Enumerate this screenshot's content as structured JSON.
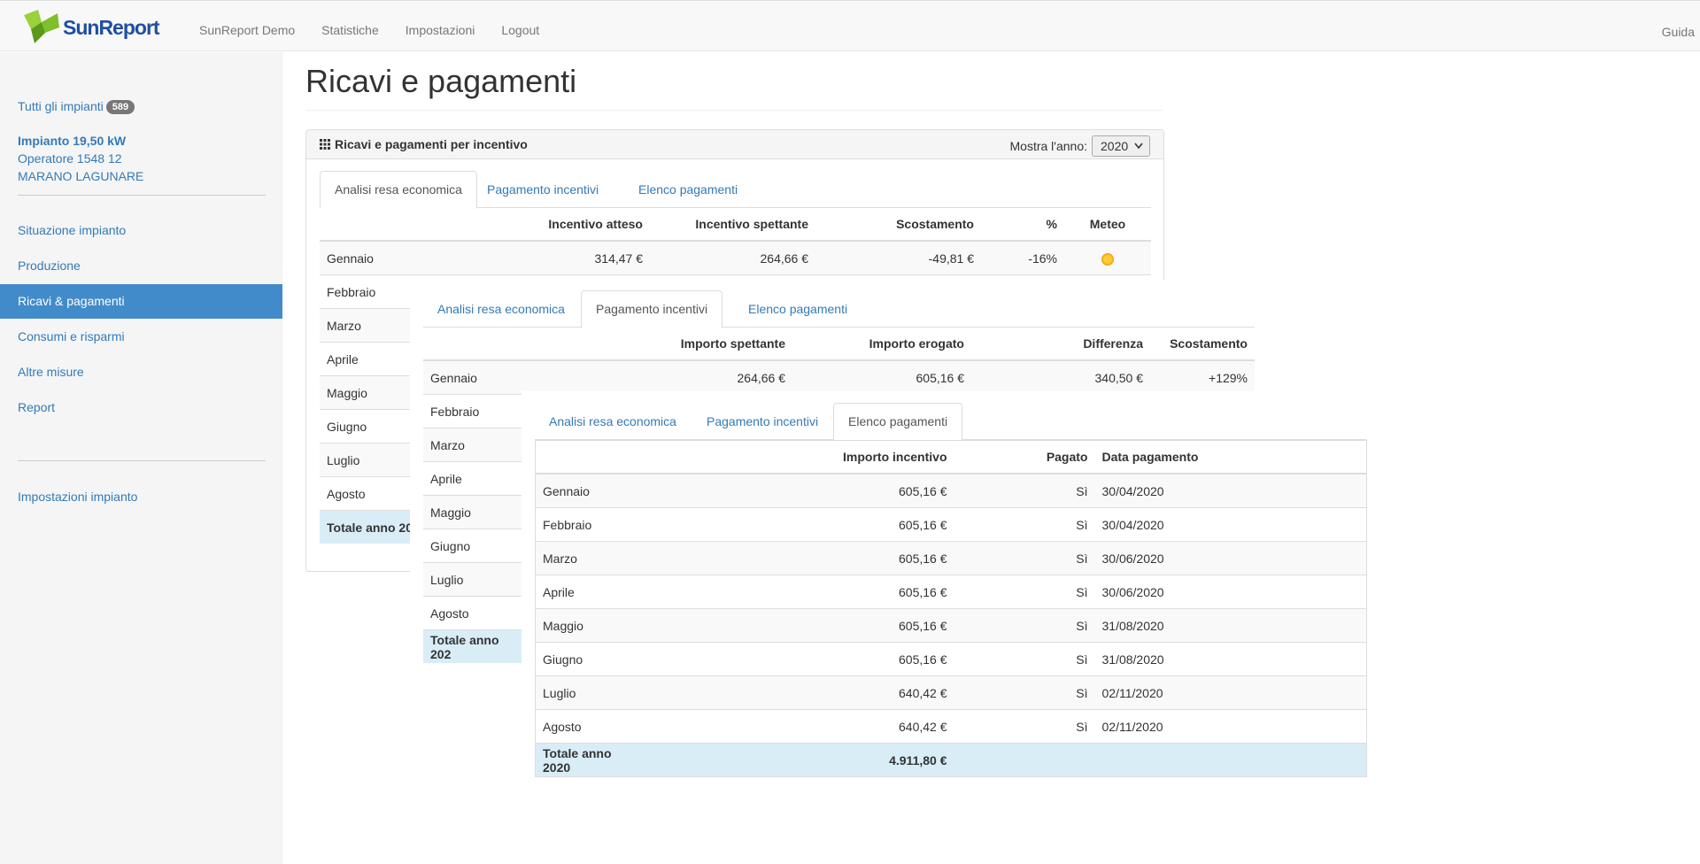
{
  "navbar": {
    "logo_text": "SunReport",
    "items": [
      "SunReport Demo",
      "Statistiche",
      "Impostazioni",
      "Logout"
    ],
    "right_link": "Guida"
  },
  "sidebar": {
    "all_plants_label": "Tutti gli impianti",
    "all_plants_count": "589",
    "plant_name": "Impianto 19,50 kW",
    "operator": "Operatore 1548 12",
    "location": "MARANO LAGUNARE",
    "menu": [
      "Situazione impianto",
      "Produzione",
      "Ricavi & pagamenti",
      "Consumi e risparmi",
      "Altre misure",
      "Report"
    ],
    "settings_link": "Impostazioni impianto"
  },
  "main": {
    "title": "Ricavi e pagamenti",
    "panel_title": "Ricavi e pagamenti per incentivo",
    "year_label": "Mostra l'anno:",
    "year_value": "2020",
    "tabs": [
      "Analisi resa economica",
      "Pagamento incentivi",
      "Elenco pagamenti"
    ]
  },
  "analisi": {
    "headers": [
      "",
      "Incentivo atteso",
      "Incentivo spettante",
      "Scostamento",
      "%",
      "Meteo"
    ],
    "first_row": [
      "Gennaio",
      "314,47 €",
      "264,66 €",
      "-49,81 €",
      "-16%"
    ],
    "months": [
      "Febbraio",
      "Marzo",
      "Aprile",
      "Maggio",
      "Giugno",
      "Luglio",
      "Agosto"
    ],
    "total_label": "Totale anno 20",
    "meteo_icon": "sun-icon"
  },
  "pagamento": {
    "headers": [
      "",
      "Importo spettante",
      "Importo erogato",
      "Differenza",
      "Scostamento"
    ],
    "first_row": [
      "Gennaio",
      "264,66 €",
      "605,16 €",
      "340,50 €",
      "+129%"
    ],
    "months": [
      "Febbraio",
      "Marzo",
      "Aprile",
      "Maggio",
      "Giugno",
      "Luglio",
      "Agosto"
    ],
    "total_label": "Totale anno 202"
  },
  "elenco": {
    "headers": [
      "",
      "Importo incentivo",
      "Pagato",
      "Data pagamento"
    ],
    "rows": [
      [
        "Gennaio",
        "605,16 €",
        "Sì",
        "30/04/2020"
      ],
      [
        "Febbraio",
        "605,16 €",
        "Sì",
        "30/04/2020"
      ],
      [
        "Marzo",
        "605,16 €",
        "Sì",
        "30/06/2020"
      ],
      [
        "Aprile",
        "605,16 €",
        "Sì",
        "30/06/2020"
      ],
      [
        "Maggio",
        "605,16 €",
        "Sì",
        "31/08/2020"
      ],
      [
        "Giugno",
        "605,16 €",
        "Sì",
        "31/08/2020"
      ],
      [
        "Luglio",
        "640,42 €",
        "Sì",
        "02/11/2020"
      ],
      [
        "Agosto",
        "640,42 €",
        "Sì",
        "02/11/2020"
      ]
    ],
    "total_label": "Totale anno 2020",
    "total_value": "4.911,80 €"
  },
  "colors": {
    "link": "#337ab7",
    "active_nav": "#428bca",
    "total_row": "#d9edf7",
    "logo_green": "#8cc63f",
    "logo_blue": "#1e4fa3"
  }
}
